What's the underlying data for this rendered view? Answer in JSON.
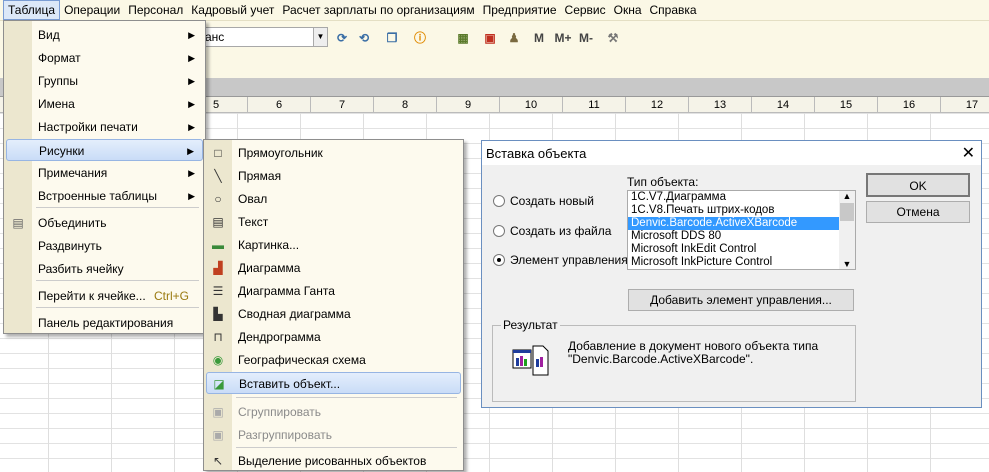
{
  "menubar": [
    "Таблица",
    "Операции",
    "Персонал",
    "Кадровый учет",
    "Расчет зарплаты по организациям",
    "Предприятие",
    "Сервис",
    "Окна",
    "Справка"
  ],
  "toolbar": {
    "combo_value": "анс",
    "m": "M",
    "mplus": "M+",
    "mminus": "M-"
  },
  "columns": [
    "5",
    "6",
    "7",
    "8",
    "9",
    "10",
    "11",
    "12",
    "13",
    "14",
    "15",
    "16",
    "17"
  ],
  "table_menu": [
    {
      "label": "Вид",
      "submenu": true
    },
    {
      "label": "Формат",
      "submenu": true
    },
    {
      "label": "Группы",
      "submenu": true
    },
    {
      "label": "Имена",
      "submenu": true
    },
    {
      "label": "Настройки печати",
      "submenu": true
    },
    {
      "label": "Рисунки",
      "submenu": true,
      "highlighted": true
    },
    {
      "label": "Примечания",
      "submenu": true
    },
    {
      "label": "Встроенные таблицы",
      "submenu": true
    },
    {
      "label": "Объединить"
    },
    {
      "label": "Раздвинуть"
    },
    {
      "label": "Разбить ячейку"
    },
    {
      "label": "Перейти к ячейке...",
      "shortcut": "Ctrl+G"
    },
    {
      "label": "Панель редактирования"
    }
  ],
  "pictures_menu": [
    {
      "label": "Прямоугольник",
      "icon": "rectangle-icon"
    },
    {
      "label": "Прямая",
      "icon": "line-icon"
    },
    {
      "label": "Овал",
      "icon": "oval-icon"
    },
    {
      "label": "Текст",
      "icon": "text-icon"
    },
    {
      "label": "Картинка...",
      "icon": "picture-icon"
    },
    {
      "label": "Диаграмма",
      "icon": "chart-icon"
    },
    {
      "label": "Диаграмма Ганта",
      "icon": "gantt-icon"
    },
    {
      "label": "Сводная диаграмма",
      "icon": "pivot-chart-icon"
    },
    {
      "label": "Дендрограмма",
      "icon": "dendrogram-icon"
    },
    {
      "label": "Географическая схема",
      "icon": "globe-icon"
    },
    {
      "label": "Вставить объект...",
      "icon": "insert-object-icon",
      "highlighted": true
    },
    {
      "label": "Сгруппировать",
      "icon": "group-icon",
      "disabled": true
    },
    {
      "label": "Разгруппировать",
      "icon": "ungroup-icon",
      "disabled": true
    },
    {
      "label": "Выделение рисованных объектов",
      "icon": "cursor-icon"
    }
  ],
  "dialog": {
    "title": "Вставка объекта",
    "radios": [
      {
        "label": "Создать новый",
        "checked": false
      },
      {
        "label": "Создать из файла",
        "checked": false
      },
      {
        "label": "Элемент управления",
        "checked": true
      }
    ],
    "type_label": "Тип объекта:",
    "types": [
      "1C.V7.Диаграмма",
      "1C.V8.Печать штрих-кодов",
      "Denvic.Barcode.ActiveXBarcode",
      "Microsoft DDS 80",
      "Microsoft InkEdit Control",
      "Microsoft InkPicture Control"
    ],
    "selected_type": "Denvic.Barcode.ActiveXBarcode",
    "ok": "OK",
    "cancel": "Отмена",
    "add_control": "Добавить элемент управления...",
    "result_label": "Результат",
    "result_text_1": "Добавление в документ нового объекта типа",
    "result_text_2": "\"Denvic.Barcode.ActiveXBarcode\"."
  }
}
